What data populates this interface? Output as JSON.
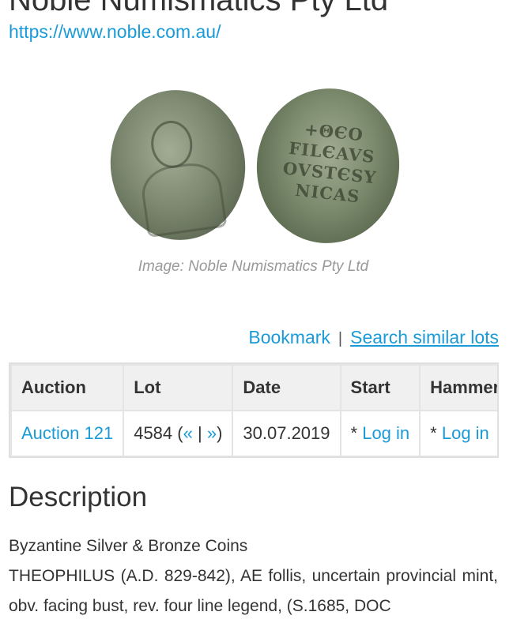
{
  "header": {
    "title": "Noble Numismatics Pty Ltd",
    "url": "https://www.noble.com.au/"
  },
  "figure": {
    "coin_reverse_legend": [
      "+ΘЄO",
      "FILЄAVS",
      "OVSTЄSY",
      "NICAS"
    ],
    "caption": "Image: Noble Numismatics Pty Ltd"
  },
  "actions": {
    "bookmark": "Bookmark",
    "separator": "|",
    "search_similar": "Search similar lots"
  },
  "lot_table": {
    "headers": [
      "Auction",
      "Lot",
      "Date",
      "Start",
      "Hammer"
    ],
    "row": {
      "auction": "Auction 121",
      "lot_number": "4584",
      "lot_open": "(",
      "prev": "«",
      "pipe": "|",
      "next": "»",
      "lot_close": ")",
      "date": "30.07.2019",
      "start_prefix": "*",
      "start_link": "Log in",
      "hammer_prefix": "*",
      "hammer_link": "Log in"
    }
  },
  "description": {
    "title": "Description",
    "category": "Byzantine Silver & Bronze Coins",
    "text": "THEOPHILUS (A.D. 829-842), AE follis, uncertain provincial mint, obv. facing bust, rev. four line legend, (S.1685, DOC"
  },
  "colors": {
    "link": "#1a9bd7",
    "text": "#333333",
    "caption": "#999999",
    "table_border": "#e0e0e0"
  }
}
